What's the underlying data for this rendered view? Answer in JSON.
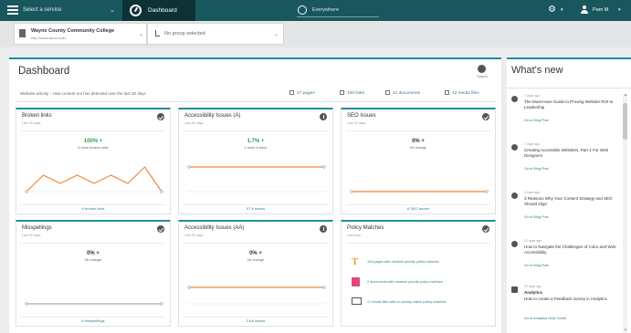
{
  "topbar": {
    "site_select": "Select a service",
    "dashboard_tab": "Dashboard",
    "search_placeholder": "Everywhere",
    "user": "Pam M"
  },
  "selectors": {
    "org_name": "Wayne County Community College",
    "org_url": "http://www.wcccd.edu",
    "group_placeholder": "No group selected"
  },
  "dashboard": {
    "title": "Dashboard",
    "options_label": "Options",
    "summary": "Website activity – new content not has detected over the last 30 days",
    "stats": [
      "17 pages",
      "100 links",
      "41 documents",
      "12 media files"
    ]
  },
  "cards": [
    {
      "title": "Broken links",
      "sub": "Last 30 days",
      "value": "100% +",
      "desc": "6 more broken links",
      "link": "6 broken links",
      "badge": "check"
    },
    {
      "title": "Accessibility Issues (A)",
      "sub": "Last 30 days",
      "value": "1.7% +",
      "desc": "1 more A issue",
      "link": "57 A issues",
      "badge": "info"
    },
    {
      "title": "SEO Issues",
      "sub": "Last 30 days",
      "value": "0% +",
      "desc": "No change",
      "link": "6 SEO issues",
      "badge": "check"
    },
    {
      "title": "Misspellings",
      "sub": "Last 30 days",
      "value": "0% +",
      "desc": "No change",
      "link": "6 misspellings",
      "badge": "check"
    },
    {
      "title": "Accessibility Issues (AA)",
      "sub": "Last 30 days",
      "value": "0% +",
      "desc": "No change",
      "link": "3 AA issues",
      "badge": "info"
    },
    {
      "title": "Policy Matches",
      "sub": "Last scan",
      "badge": "check"
    }
  ],
  "policy": [
    {
      "text": "100 pages with medium priority policy matches",
      "icon": "text-icon",
      "color": "#f0a020"
    },
    {
      "text": "2 documents with medium priority policy matches",
      "icon": "document-icon",
      "color": "#e0457b"
    },
    {
      "text": "17 media files with no priority match policy matches",
      "icon": "media-icon",
      "color": "#555555"
    }
  ],
  "chart_data": [
    {
      "type": "line",
      "y": [
        0,
        2,
        1,
        2,
        1,
        2,
        1,
        3,
        0
      ],
      "ylim": [
        0,
        4
      ]
    },
    {
      "type": "line",
      "y": [
        3,
        3,
        3,
        3,
        3,
        3,
        3,
        3,
        3
      ],
      "ylim": [
        0,
        4
      ]
    },
    {
      "type": "line",
      "y": [
        0,
        0,
        0,
        0,
        0,
        0,
        0,
        0,
        0
      ],
      "ylim": [
        0,
        4
      ]
    },
    {
      "type": "line",
      "y": [
        0,
        0,
        0,
        0,
        0,
        0,
        0,
        0,
        0
      ],
      "ylim": [
        0,
        4
      ]
    },
    {
      "type": "line",
      "y": [
        2,
        2,
        2,
        2,
        2,
        2,
        2,
        2,
        2
      ],
      "ylim": [
        0,
        4
      ]
    }
  ],
  "whatsnew": {
    "title": "What's new",
    "items": [
      {
        "date": "7 days ago",
        "title": "The Must-Have Guide to Proving Website ROI to Leadership",
        "link": "Go to Blog Post",
        "icon": "blog-icon"
      },
      {
        "date": "7 days ago",
        "title": "Creating Accessible Websites, Part 1 For Web Designers",
        "link": "Go to Blog Post",
        "icon": "blog-icon"
      },
      {
        "date": "9 days ago",
        "title": "3 Reasons Why Your Content Strategy and SEO Should Align",
        "link": "Go to Blog Post",
        "icon": "blog-icon"
      },
      {
        "date": "21 days ago",
        "title": "How to Navigate the Challenges of Color and Web Accessibility",
        "link": "Go to Blog Post",
        "icon": "blog-icon"
      },
      {
        "date": "22 days ago",
        "title": "Analytics",
        "desc": "How to create a Feedback survey in Analytics",
        "link": "Go to Analytics Help Center",
        "icon": "book-icon"
      }
    ]
  }
}
